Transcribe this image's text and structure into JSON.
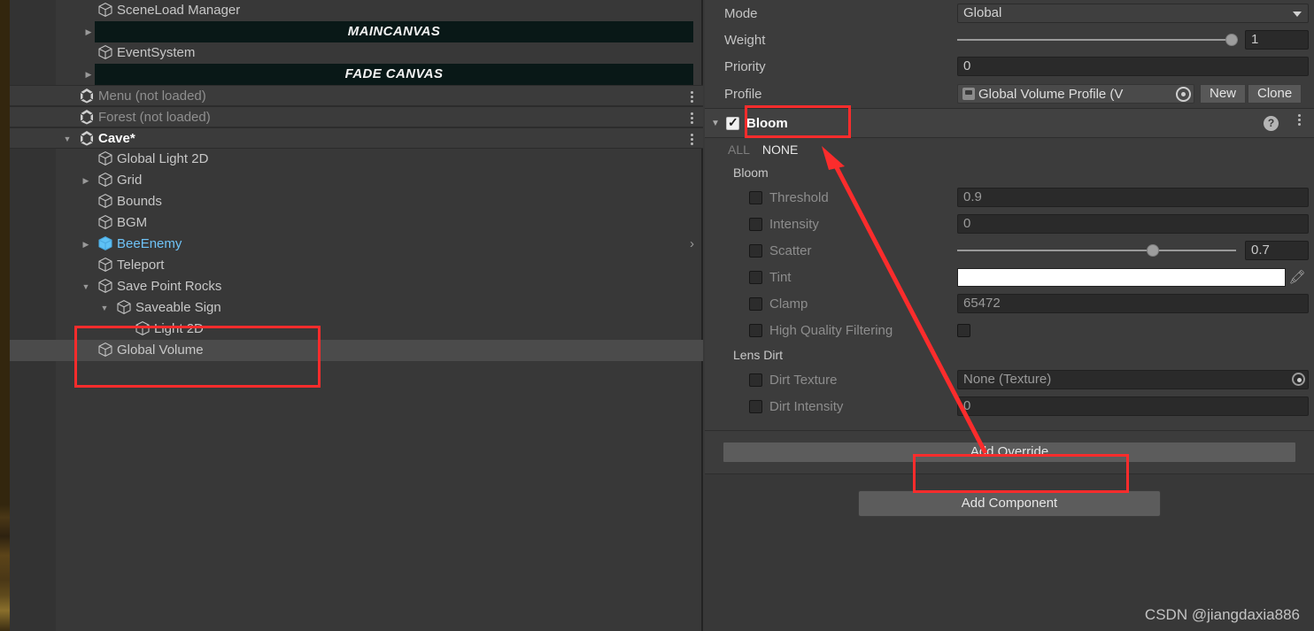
{
  "hierarchy": {
    "rows": [
      {
        "label": "SceneLoad Manager",
        "type": "gameobject",
        "indent": 3,
        "twirl": "none",
        "state": "normal"
      },
      {
        "label": "MAINCANVAS",
        "type": "banner",
        "indent": 3,
        "twirl": "collapsed",
        "state": "normal"
      },
      {
        "label": "EventSystem",
        "type": "gameobject",
        "indent": 3,
        "twirl": "none",
        "state": "normal"
      },
      {
        "label": "FADE CANVAS",
        "type": "banner",
        "indent": 3,
        "twirl": "collapsed",
        "state": "normal"
      },
      {
        "label": "Menu (not loaded)",
        "type": "scene",
        "indent": 2,
        "twirl": "none",
        "state": "unloaded"
      },
      {
        "label": "Forest (not loaded)",
        "type": "scene",
        "indent": 2,
        "twirl": "none",
        "state": "unloaded"
      },
      {
        "label": "Cave*",
        "type": "scene",
        "indent": 2,
        "twirl": "expanded",
        "state": "active"
      },
      {
        "label": "Global Light 2D",
        "type": "gameobject",
        "indent": 3,
        "twirl": "none",
        "state": "normal"
      },
      {
        "label": "Grid",
        "type": "gameobject",
        "indent": 3,
        "twirl": "collapsed",
        "state": "normal"
      },
      {
        "label": "Bounds",
        "type": "gameobject",
        "indent": 3,
        "twirl": "none",
        "state": "normal"
      },
      {
        "label": "BGM",
        "type": "gameobject",
        "indent": 3,
        "twirl": "none",
        "state": "normal"
      },
      {
        "label": "BeeEnemy",
        "type": "prefab",
        "indent": 3,
        "twirl": "collapsed",
        "state": "normal"
      },
      {
        "label": "Teleport",
        "type": "gameobject",
        "indent": 3,
        "twirl": "none",
        "state": "normal"
      },
      {
        "label": "Save Point Rocks",
        "type": "gameobject",
        "indent": 3,
        "twirl": "expanded",
        "state": "normal"
      },
      {
        "label": "Saveable Sign",
        "type": "gameobject",
        "indent": 4,
        "twirl": "expanded",
        "state": "normal"
      },
      {
        "label": "Light 2D",
        "type": "gameobject",
        "indent": 5,
        "twirl": "none",
        "state": "normal"
      },
      {
        "label": "Global Volume",
        "type": "gameobject",
        "indent": 3,
        "twirl": "none",
        "state": "selected"
      }
    ]
  },
  "inspector": {
    "volume": {
      "mode": {
        "label": "Mode",
        "value": "Global"
      },
      "weight": {
        "label": "Weight",
        "value": "1",
        "slider_pct": 100
      },
      "priority": {
        "label": "Priority",
        "value": "0"
      },
      "profile": {
        "label": "Profile",
        "value": "Global Volume Profile (V",
        "new_label": "New",
        "clone_label": "Clone"
      }
    },
    "bloom": {
      "title": "Bloom",
      "enabled": true,
      "all_label": "ALL",
      "none_label": "NONE",
      "group_bloom": "Bloom",
      "group_lens_dirt": "Lens Dirt",
      "properties": [
        {
          "name": "Threshold",
          "kind": "number",
          "value": "0.9",
          "overridden": false
        },
        {
          "name": "Intensity",
          "kind": "number",
          "value": "0",
          "overridden": false
        },
        {
          "name": "Scatter",
          "kind": "slider",
          "value": "0.7",
          "slider_pct": 70,
          "overridden": false
        },
        {
          "name": "Tint",
          "kind": "color",
          "value": "#FFFFFF",
          "overridden": false
        },
        {
          "name": "Clamp",
          "kind": "number",
          "value": "65472",
          "overridden": false
        },
        {
          "name": "High Quality Filtering",
          "kind": "toggle",
          "value": "",
          "overridden": false
        }
      ],
      "lens_dirt_properties": [
        {
          "name": "Dirt Texture",
          "kind": "object",
          "value": "None (Texture)",
          "overridden": false
        },
        {
          "name": "Dirt Intensity",
          "kind": "number",
          "value": "0",
          "overridden": false
        }
      ]
    },
    "add_override_label": "Add Override",
    "add_component_label": "Add Component"
  },
  "watermark": "CSDN @jiangdaxia886",
  "colors": {
    "annotation": "#fb2c2c",
    "panel_bg": "#383838",
    "banner_bg": "#091817",
    "prefab_blue": "#6fc3f7",
    "tint": "#FFFFFF"
  }
}
